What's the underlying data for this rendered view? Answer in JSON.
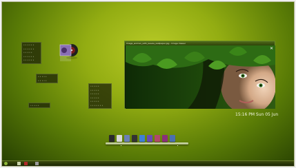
{
  "left_menus": {
    "menu1": {
      "items": [
        "• • • • • •",
        "• • • • • •",
        "• • • • •",
        "• • • • • •",
        "• • • • • •"
      ]
    },
    "menu2": {
      "items": [
        "• • • • •",
        "• • • • •"
      ]
    },
    "menu3": {
      "items": [
        "• • • • •",
        "• • • • •",
        "• • • • •",
        "• • • • •",
        "• • • • •",
        "• • • • • • •"
      ]
    },
    "menu4": {
      "items": [
        "• • • • •"
      ]
    }
  },
  "image_viewer": {
    "title": "Image_woman_with_leaves_wallpaper.jpg - Image Viewer",
    "close_label": "✕"
  },
  "clock": {
    "text": "15:16 PM Sun 05 Jun"
  },
  "dock": {
    "icons": [
      {
        "name": "terminal-icon",
        "color": "#2a2a2a"
      },
      {
        "name": "files-icon",
        "color": "#d9d9d9"
      },
      {
        "name": "image-viewer-icon",
        "color": "#6b7fb5"
      },
      {
        "name": "music-icon",
        "color": "#333333"
      },
      {
        "name": "globe-icon",
        "color": "#3f7fd6"
      },
      {
        "name": "chat-icon",
        "color": "#6a4ab5"
      },
      {
        "name": "media-player-icon",
        "color": "#b04a6a"
      },
      {
        "name": "photos-icon",
        "color": "#8a2f7a"
      },
      {
        "name": "settings-icon",
        "color": "#4a6fb0"
      }
    ]
  },
  "taskbar": {
    "icons": [
      "menu-icon",
      "desktop-icon",
      "window-icon",
      "app-icon"
    ]
  }
}
